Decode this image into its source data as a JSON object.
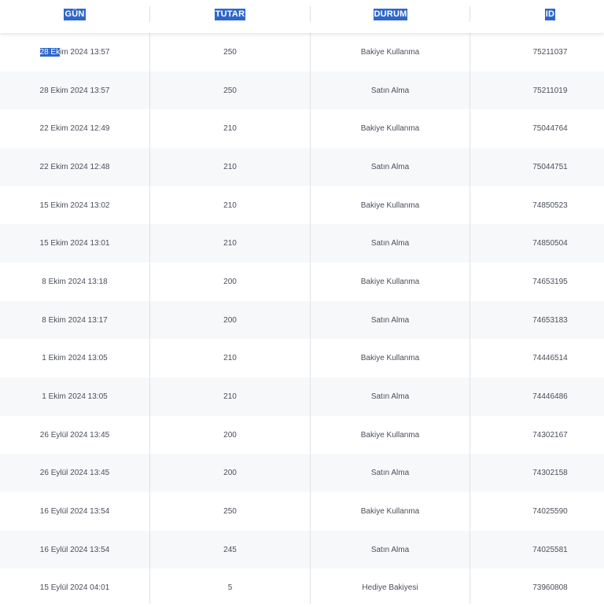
{
  "headers": {
    "date": "GÜN",
    "amount": "TUTAR",
    "status": "DURUM",
    "id": "ID"
  },
  "rows": [
    {
      "date_sel": "28 Ek",
      "date_rest": "im 2024 13:57",
      "amount": "250",
      "status": "Bakiye Kullanma",
      "id": "75211037"
    },
    {
      "date": "28 Ekim 2024 13:57",
      "amount": "250",
      "status": "Satın Alma",
      "id": "75211019"
    },
    {
      "date": "22 Ekim 2024 12:49",
      "amount": "210",
      "status": "Bakiye Kullanma",
      "id": "75044764"
    },
    {
      "date": "22 Ekim 2024 12:48",
      "amount": "210",
      "status": "Satın Alma",
      "id": "75044751"
    },
    {
      "date": "15 Ekim 2024 13:02",
      "amount": "210",
      "status": "Bakiye Kullanma",
      "id": "74850523"
    },
    {
      "date": "15 Ekim 2024 13:01",
      "amount": "210",
      "status": "Satın Alma",
      "id": "74850504"
    },
    {
      "date": "8 Ekim 2024 13:18",
      "amount": "200",
      "status": "Bakiye Kullanma",
      "id": "74653195"
    },
    {
      "date": "8 Ekim 2024 13:17",
      "amount": "200",
      "status": "Satın Alma",
      "id": "74653183"
    },
    {
      "date": "1 Ekim 2024 13:05",
      "amount": "210",
      "status": "Bakiye Kullanma",
      "id": "74446514"
    },
    {
      "date": "1 Ekim 2024 13:05",
      "amount": "210",
      "status": "Satın Alma",
      "id": "74446486"
    },
    {
      "date": "26 Eylül 2024 13:45",
      "amount": "200",
      "status": "Bakiye Kullanma",
      "id": "74302167"
    },
    {
      "date": "26 Eylül 2024 13:45",
      "amount": "200",
      "status": "Satın Alma",
      "id": "74302158"
    },
    {
      "date": "16 Eylül 2024 13:54",
      "amount": "250",
      "status": "Bakiye Kullanma",
      "id": "74025590"
    },
    {
      "date": "16 Eylül 2024 13:54",
      "amount": "245",
      "status": "Satın Alma",
      "id": "74025581"
    },
    {
      "date": "15 Eylül 2024 04:01",
      "amount": "5",
      "status": "Hediye Bakiyesi",
      "id": "73960808"
    }
  ]
}
